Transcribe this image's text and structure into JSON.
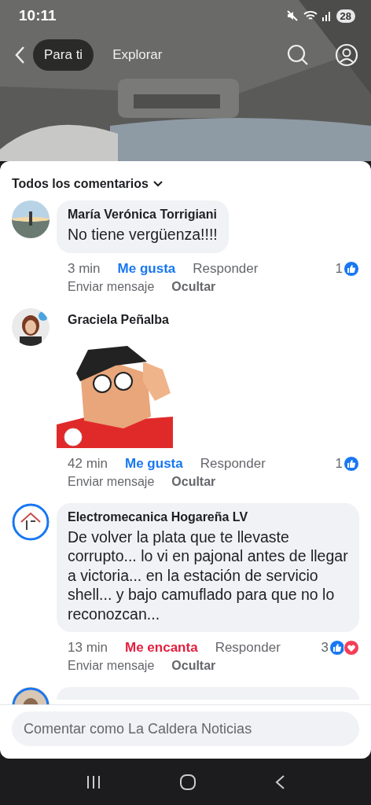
{
  "status_bar": {
    "time": "10:11",
    "battery": "28"
  },
  "nav": {
    "tabs": [
      {
        "label": "Para ti",
        "selected": true
      },
      {
        "label": "Explorar",
        "selected": false
      }
    ]
  },
  "comments_sheet": {
    "title": "Todos los comentarios",
    "comments": [
      {
        "kind": "text",
        "author": "María Verónica Torrigiani",
        "text": "No tiene vergüenza!!!!",
        "time": "3 min",
        "reaction": {
          "label": "Me gusta",
          "kind": "like"
        },
        "reply": "Responder",
        "count": "1",
        "reactions": [
          {
            "kind": "like"
          }
        ],
        "message": "Enviar mensaje",
        "hide": "Ocultar"
      },
      {
        "kind": "sticker",
        "author": "Graciela Peñalba",
        "time": "42 min",
        "reaction": {
          "label": "Me gusta",
          "kind": "like"
        },
        "reply": "Responder",
        "count": "1",
        "reactions": [
          {
            "kind": "like"
          }
        ],
        "message": "Enviar mensaje",
        "hide": "Ocultar"
      },
      {
        "kind": "text",
        "author": "Electromecanica Hogareña LV",
        "text": "De volver la plata que te llevaste corrupto... lo vi en pajonal antes de llegar a victoria... en la estación de servicio shell... y bajo camuflado para que no lo reconozcan...",
        "time": "13 min",
        "reaction": {
          "label": "Me encanta",
          "kind": "love"
        },
        "reply": "Responder",
        "count": "3",
        "reactions": [
          {
            "kind": "like"
          },
          {
            "kind": "love"
          }
        ],
        "message": "Enviar mensaje",
        "hide": "Ocultar"
      },
      {
        "kind": "cut"
      }
    ],
    "input": {
      "placeholder": "Comentar como La Caldera Noticias"
    }
  }
}
